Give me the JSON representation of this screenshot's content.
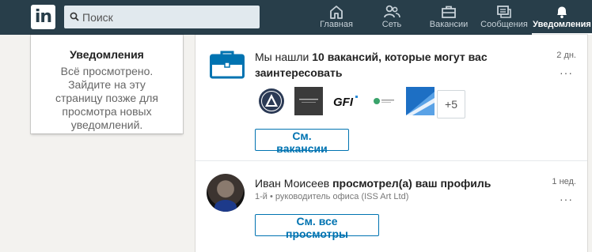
{
  "brand": {
    "logo_text": "in",
    "color": "#283e4a",
    "accent": "#0073b1"
  },
  "search": {
    "placeholder": "Поиск"
  },
  "nav": {
    "items": [
      {
        "label": "Главная",
        "icon": "home-icon"
      },
      {
        "label": "Сеть",
        "icon": "network-icon"
      },
      {
        "label": "Вакансии",
        "icon": "jobs-icon"
      },
      {
        "label": "Сообщения",
        "icon": "messages-icon"
      },
      {
        "label": "Уведомления",
        "icon": "bell-icon",
        "active": true
      }
    ]
  },
  "sidebar": {
    "title": "Уведомления",
    "text": "Всё просмотрено. Зайдите на эту страницу позже для просмотра новых уведомлений."
  },
  "notifications": [
    {
      "text_plain": "Мы нашли ",
      "text_bold": "10 вакансий, которые могут вас заинтересовать",
      "time": "2 дн.",
      "more": "···",
      "company_logos": [
        "logo-1",
        "logo-2",
        "GFI",
        "logo-4",
        "logo-5"
      ],
      "gfi_text": "GFI",
      "extra_count": "+5",
      "button": "См. вакансии"
    },
    {
      "name": "Иван Моисеев",
      "text_bold": " просмотрел(а) ваш профиль",
      "subtitle": "1-й • руководитель офиса (ISS Art Ltd)",
      "time": "1 нед.",
      "more": "···",
      "button": "См. все просмотры"
    }
  ]
}
